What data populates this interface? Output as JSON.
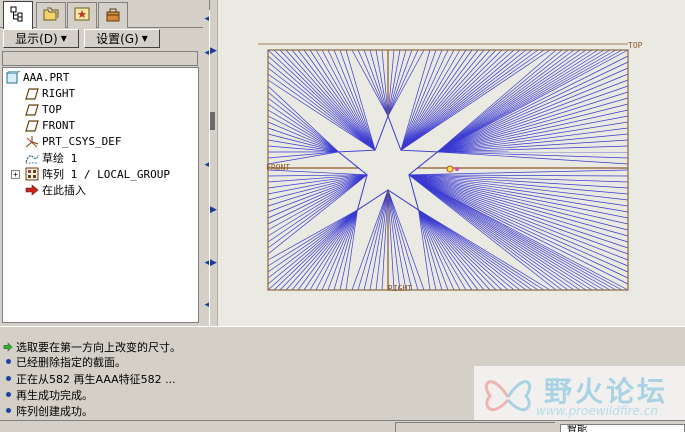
{
  "navigator": {
    "tabs": [
      {
        "name": "model-tree-tab",
        "icon": "model-tree-icon",
        "active": true
      },
      {
        "name": "folder-browser-tab",
        "icon": "folder-icon",
        "active": false
      },
      {
        "name": "favorites-tab",
        "icon": "favorites-icon",
        "active": false
      },
      {
        "name": "connections-tab",
        "icon": "toolbox-icon",
        "active": false
      }
    ],
    "show_button": "显示(D)",
    "settings_button": "设置(G)",
    "tree": [
      {
        "label": "AAA.PRT",
        "icon": "part-icon",
        "level": 0
      },
      {
        "label": "RIGHT",
        "icon": "datum-plane-icon",
        "level": 1
      },
      {
        "label": "TOP",
        "icon": "datum-plane-icon",
        "level": 1
      },
      {
        "label": "FRONT",
        "icon": "datum-plane-icon",
        "level": 1
      },
      {
        "label": "PRT_CSYS_DEF",
        "icon": "csys-icon",
        "level": 1
      },
      {
        "label": "草绘 1",
        "icon": "sketch-icon",
        "level": 1
      },
      {
        "label": "阵列 1 / LOCAL_GROUP",
        "icon": "pattern-icon",
        "level": 1,
        "expandable": true
      },
      {
        "label": "在此插入",
        "icon": "insert-here-arrow-icon",
        "level": 1
      }
    ]
  },
  "graphics": {
    "datum_labels": {
      "top": "TOP",
      "front": "FRONT",
      "right": "RIGHT"
    },
    "colors": {
      "background": "#eae9e2",
      "rays": "#3a3ad2",
      "frame": "#8b6a3f",
      "datum": "#8b5a2b"
    }
  },
  "messages": [
    {
      "text": "选取要在第一方向上改变的尺寸。",
      "icon": "prompt-arrow-icon"
    },
    {
      "text": "已经删除指定的截面。",
      "icon": "info-bullet-icon"
    },
    {
      "text": "正在从582 再生AAA特征582 ...",
      "icon": "info-bullet-icon"
    },
    {
      "text": "再生成功完成。",
      "icon": "info-bullet-icon"
    },
    {
      "text": "阵列创建成功。",
      "icon": "info-bullet-icon"
    }
  ],
  "watermark": {
    "title": "野火论坛",
    "url": "www.proewildfire.cn"
  },
  "statusbar": {
    "filter_text": "智能"
  }
}
